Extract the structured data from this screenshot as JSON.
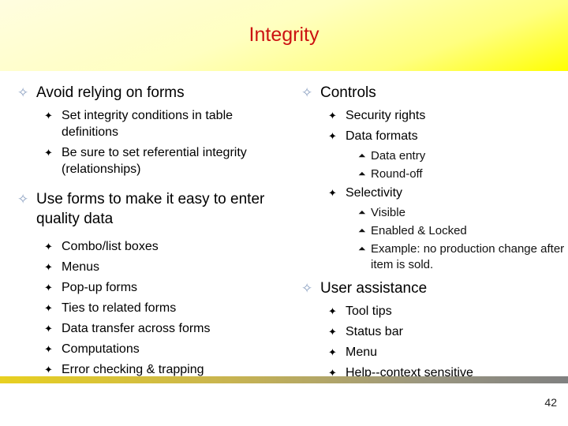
{
  "header": {
    "title": "Integrity"
  },
  "left_column": {
    "sections": [
      {
        "label": "Avoid relying on forms",
        "items": [
          {
            "label": "Set integrity conditions in table definitions"
          },
          {
            "label": "Be sure to set referential integrity (relationships)"
          }
        ]
      },
      {
        "label": "Use forms to make it easy to enter quality data",
        "items": [
          {
            "label": "Combo/list boxes"
          },
          {
            "label": "Menus"
          },
          {
            "label": "Pop-up forms"
          },
          {
            "label": "Ties to related forms"
          },
          {
            "label": "Data transfer across forms"
          },
          {
            "label": "Computations"
          },
          {
            "label": "Error checking & trapping"
          }
        ]
      }
    ]
  },
  "right_column": {
    "sections": [
      {
        "label": "Controls",
        "items": [
          {
            "label": "Security rights",
            "subitems": []
          },
          {
            "label": "Data formats",
            "subitems": [
              "Data entry",
              "Round-off"
            ]
          },
          {
            "label": "Selectivity",
            "subitems": [
              "Visible",
              "Enabled & Locked",
              "Example:  no production change after item is sold."
            ]
          }
        ]
      },
      {
        "label": "User assistance",
        "items": [
          {
            "label": "Tool tips"
          },
          {
            "label": "Status bar"
          },
          {
            "label": "Menu"
          },
          {
            "label": "Help--context sensitive"
          }
        ]
      }
    ]
  },
  "bullets": {
    "level1": "✧",
    "level2": "✦",
    "level3": "⏶"
  },
  "colors": {
    "title": "#cc1111",
    "level1_bullet": "#8ea3c3"
  },
  "footer": {
    "page_number": "42"
  }
}
